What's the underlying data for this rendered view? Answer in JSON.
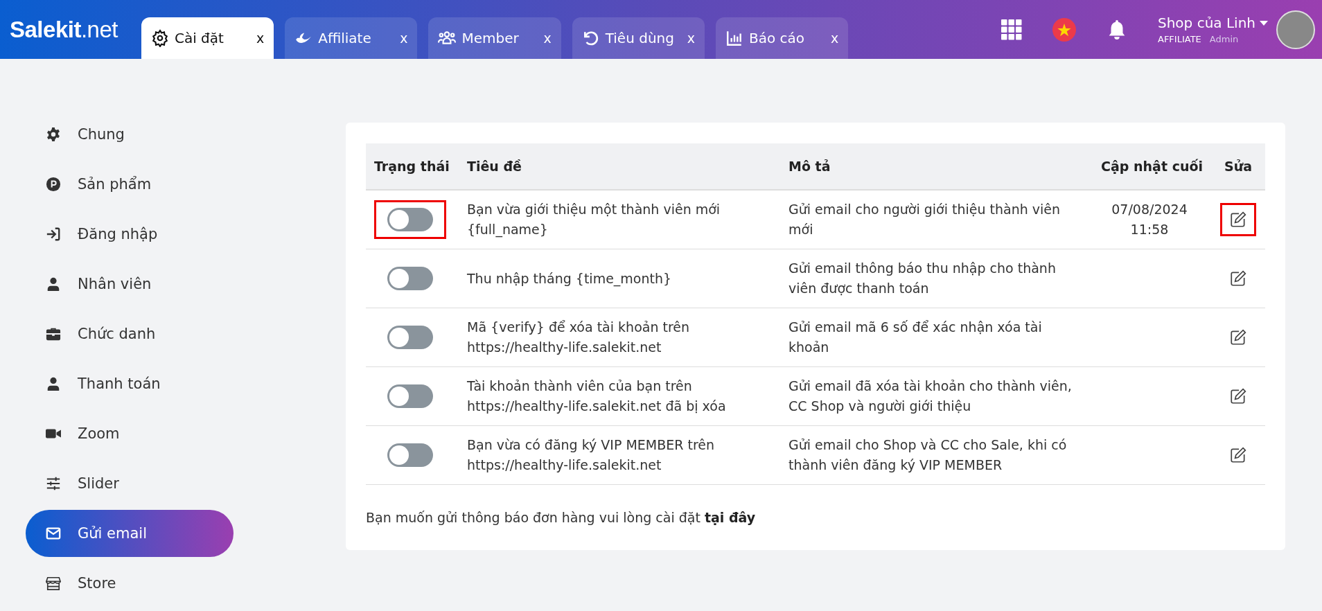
{
  "logo": "**Salekit**.net",
  "tabs": [
    {
      "label": "Cài đặt",
      "selected": true,
      "close": "x"
    },
    {
      "label": "Affiliate",
      "selected": false,
      "close": "x"
    },
    {
      "label": "Member",
      "selected": false,
      "close": "x"
    },
    {
      "label": "Tiêu dùng",
      "selected": false,
      "close": "x"
    },
    {
      "label": "Báo cáo",
      "selected": false,
      "close": "x"
    }
  ],
  "user": {
    "name": "Shop của Linh",
    "role": "AFFILIATE",
    "level": "Admin"
  },
  "sidebar": {
    "items": [
      {
        "label": "Chung",
        "selected": false
      },
      {
        "label": "Sản phẩm",
        "selected": false
      },
      {
        "label": "Đăng nhập",
        "selected": false
      },
      {
        "label": "Nhân viên",
        "selected": false
      },
      {
        "label": "Chức danh",
        "selected": false
      },
      {
        "label": "Thanh toán",
        "selected": false
      },
      {
        "label": "Zoom",
        "selected": false
      },
      {
        "label": "Slider",
        "selected": false
      },
      {
        "label": "Gửi email",
        "selected": true
      },
      {
        "label": "Store",
        "selected": false
      }
    ]
  },
  "table": {
    "columns": [
      "Trạng thái",
      "Tiêu đề",
      "Mô tả",
      "Cập nhật cuối",
      "Sửa"
    ],
    "rows": [
      {
        "on": false,
        "highlighted": true,
        "title": "Bạn vừa giới thiệu một thành viên mới {full_name}",
        "description": "Gửi email cho người giới thiệu thành viên mới",
        "updated": "07/08/2024 11:58"
      },
      {
        "on": false,
        "highlighted": false,
        "title": "Thu nhập tháng {time_month}",
        "description": "Gửi email thông báo thu nhập cho thành viên được thanh toán"
      },
      {
        "on": false,
        "highlighted": false,
        "title": "Mã {verify} để xóa tài khoản trên https://healthy-life.salekit.net",
        "description": "Gửi email mã 6 số để xác nhận xóa tài khoản"
      },
      {
        "on": false,
        "highlighted": false,
        "title": "Tài khoản thành viên của bạn trên https://healthy-life.salekit.net đã bị xóa",
        "description": "Gửi email đã xóa tài khoản cho thành viên, CC Shop và người giới thiệu"
      },
      {
        "on": false,
        "highlighted": false,
        "title": "Bạn vừa có đăng ký VIP MEMBER trên https://healthy-life.salekit.net",
        "description": "Gửi email cho Shop và CC cho Sale, khi có thành viên đăng ký VIP MEMBER"
      }
    ]
  },
  "note": {
    "text": "Bạn muốn gửi thông báo đơn hàng vui lòng cài đặt",
    "link": "tại đây"
  }
}
